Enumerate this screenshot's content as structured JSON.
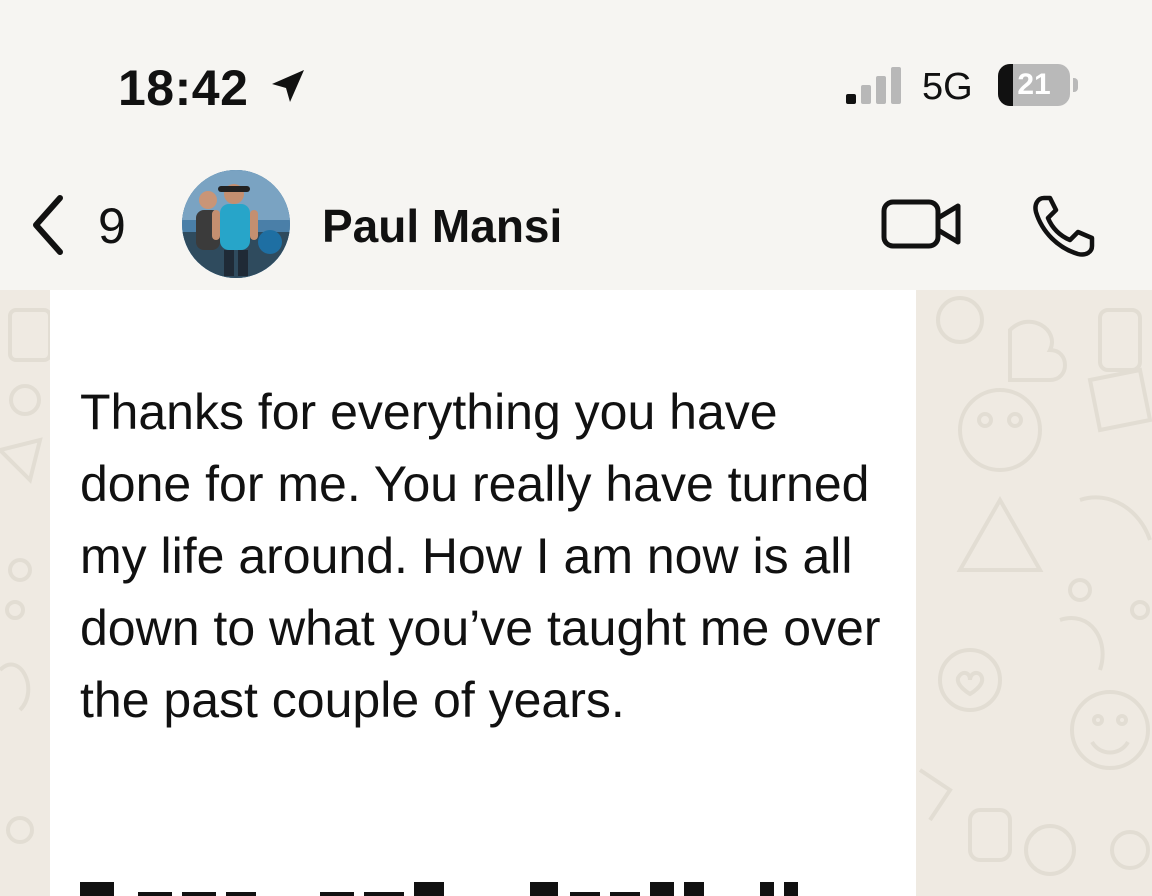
{
  "status_bar": {
    "time": "18:42",
    "location_icon": "location-arrow-icon",
    "signal_icon": "cellular-signal-icon",
    "signal_bars_active": 1,
    "signal_bars_total": 4,
    "network": "5G",
    "battery_percent": "21",
    "battery_level": 0.21
  },
  "header": {
    "back_icon": "chevron-left-icon",
    "unread_count": "9",
    "contact_name": "Paul Mansi",
    "video_icon": "video-camera-icon",
    "phone_icon": "phone-icon"
  },
  "chat": {
    "message": "Thanks for everything you have done for me. You really have turned my life around. How I am now is all down to what you’ve taught me over the past couple of years."
  },
  "colors": {
    "header_bg": "#f6f5f2",
    "chat_bg": "#efeae2",
    "bubble_bg": "#ffffff",
    "text": "#111111"
  }
}
